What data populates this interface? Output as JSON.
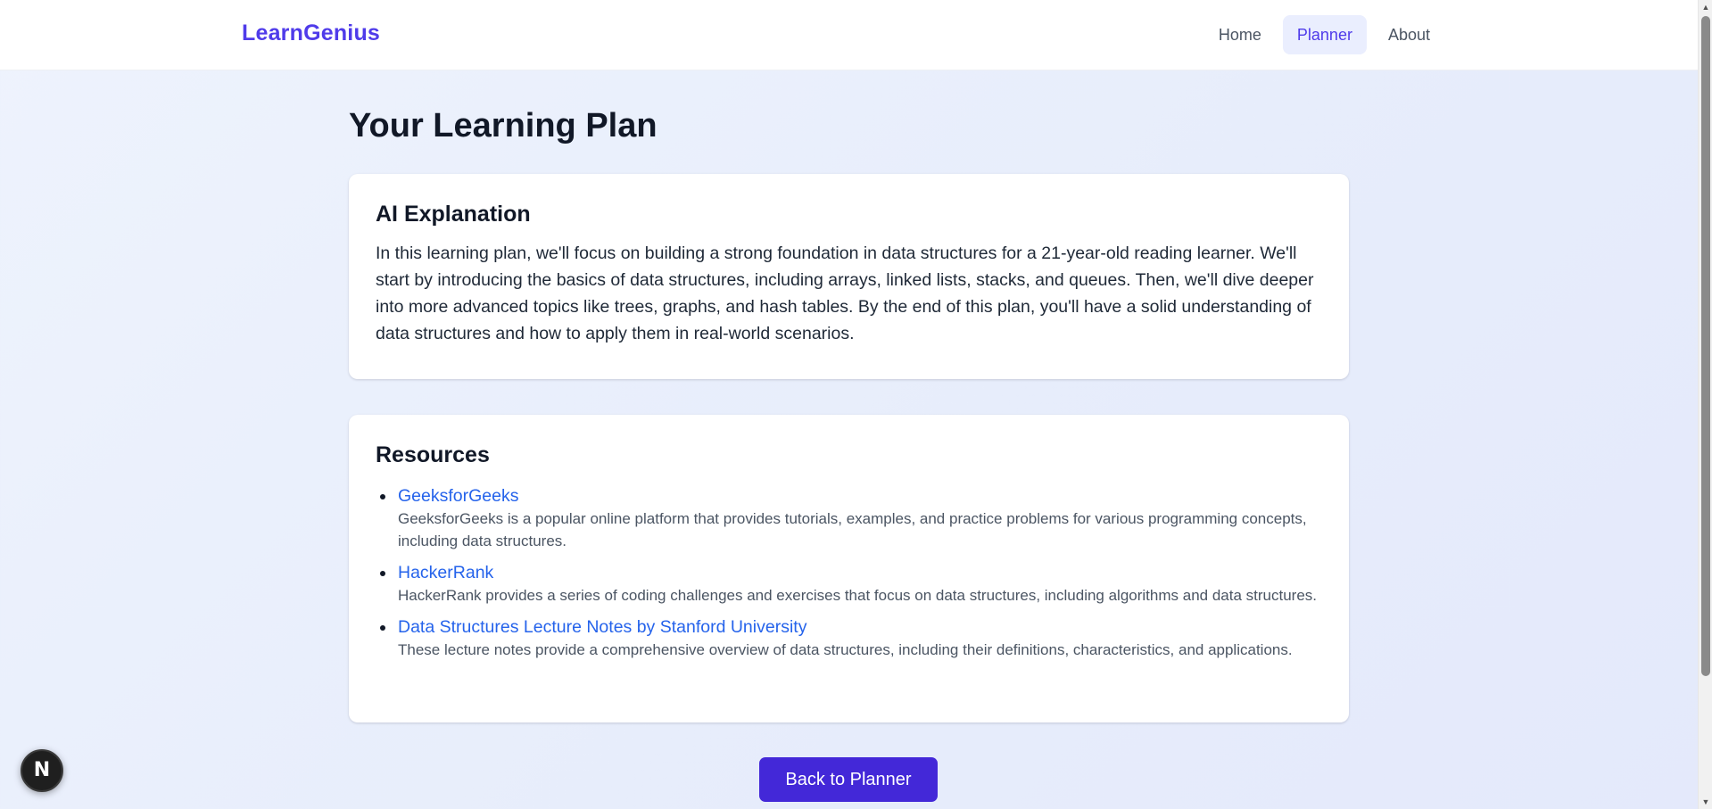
{
  "header": {
    "brand": "LearnGenius",
    "nav": [
      {
        "label": "Home",
        "active": false
      },
      {
        "label": "Planner",
        "active": true
      },
      {
        "label": "About",
        "active": false
      }
    ]
  },
  "main": {
    "title": "Your Learning Plan",
    "ai_card": {
      "heading": "AI Explanation",
      "text": "In this learning plan, we'll focus on building a strong foundation in data structures for a 21-year-old reading learner. We'll start by introducing the basics of data structures, including arrays, linked lists, stacks, and queues. Then, we'll dive deeper into more advanced topics like trees, graphs, and hash tables. By the end of this plan, you'll have a solid understanding of data structures and how to apply them in real-world scenarios."
    },
    "resources_card": {
      "heading": "Resources",
      "items": [
        {
          "title": "GeeksforGeeks",
          "description": "GeeksforGeeks is a popular online platform that provides tutorials, examples, and practice problems for various programming concepts, including data structures."
        },
        {
          "title": "HackerRank",
          "description": "HackerRank provides a series of coding challenges and exercises that focus on data structures, including algorithms and data structures."
        },
        {
          "title": "Data Structures Lecture Notes by Stanford University",
          "description": "These lecture notes provide a comprehensive overview of data structures, including their definitions, characteristics, and applications."
        }
      ]
    },
    "back_button": "Back to Planner"
  },
  "dev_badge": {
    "label": "N",
    "icon": "nextjs-icon"
  },
  "colors": {
    "brand": "#4f3bea",
    "link": "#2563eb",
    "button": "#4328d8",
    "nav_active_bg": "#eaeefe"
  }
}
